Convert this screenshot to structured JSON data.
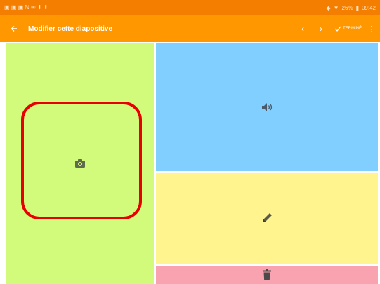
{
  "status_bar": {
    "left_glyphs": "▣ ▣ ▣ ℕ ✉ ⬇ ⬇",
    "battery": "26%",
    "time": "09:42"
  },
  "toolbar": {
    "title": "Modifier cette diapositive",
    "done_label": "TERMINÉ"
  },
  "panels": {
    "photo": {
      "icon": "camera-icon",
      "color": "#d2fa7b"
    },
    "audio": {
      "icon": "speaker-icon",
      "color": "#81cffe"
    },
    "text": {
      "icon": "pencil-icon",
      "color": "#fff48d"
    },
    "delete": {
      "icon": "trash-icon",
      "color": "#f9a3b0"
    }
  },
  "accent_colors": {
    "toolbar": "#ff9800",
    "status_bar": "#f47e00",
    "highlight": "#e60000"
  }
}
